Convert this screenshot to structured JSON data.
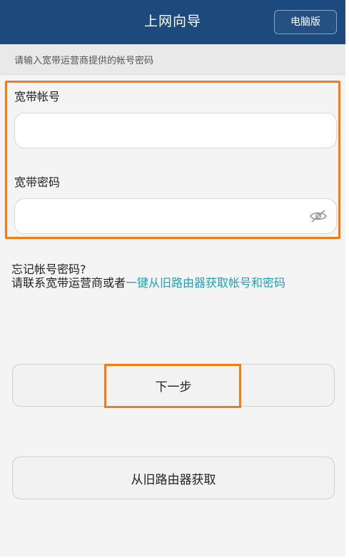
{
  "header": {
    "title": "上网向导",
    "pc_version_label": "电脑版",
    "bg_color": "#1d4a7d"
  },
  "hint": {
    "text": "请输入宽带运营商提供的帐号密码"
  },
  "form": {
    "account_label": "宽带帐号",
    "account_value": "",
    "password_label": "宽带密码",
    "password_value": "",
    "highlight_color": "#f57c12",
    "password_toggle_icon": "eye-hidden-icon"
  },
  "help": {
    "title": "忘记帐号密码?",
    "prefix": "请联系宽带运营商或者",
    "link_text": "一键从旧路由器获取帐号和密码",
    "link_color": "#1fa2b4"
  },
  "buttons": {
    "next_label": "下一步",
    "get_from_old_router_label": "从旧路由器获取"
  }
}
